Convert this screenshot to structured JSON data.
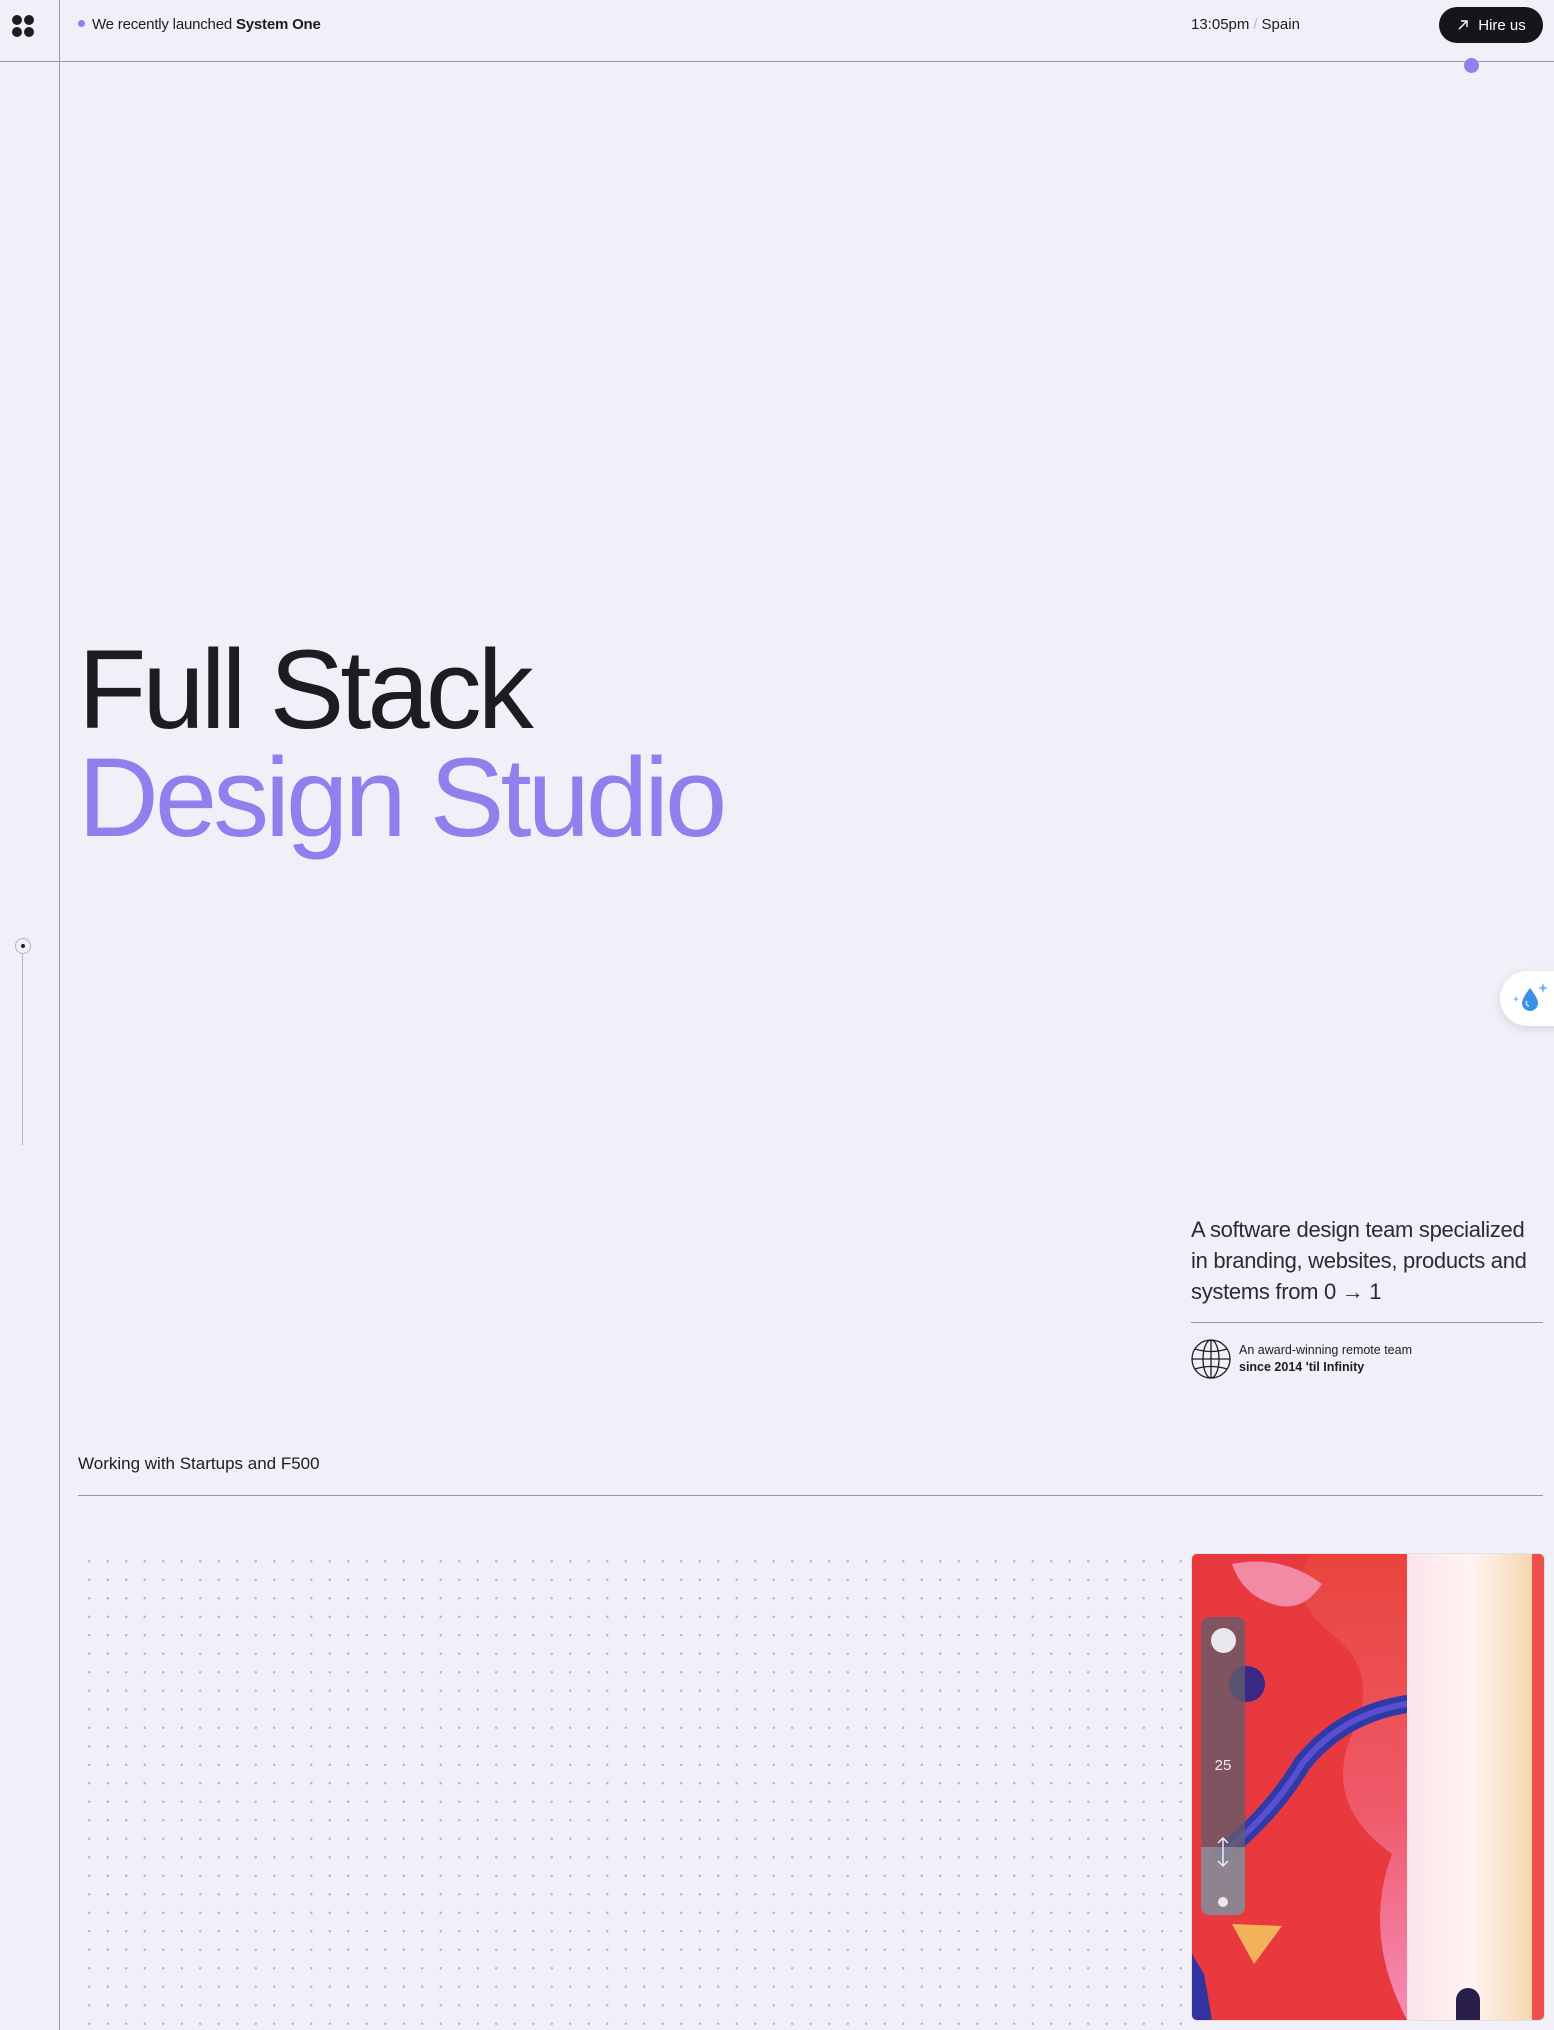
{
  "header": {
    "announcement_prefix": "We recently launched",
    "announcement_strong": "System One",
    "time": "13:05pm",
    "separator": "/",
    "location": "Spain",
    "hire_label": "Hire us"
  },
  "hero": {
    "line1": "Full Stack",
    "line2": "Design Studio"
  },
  "intro": {
    "text": "A software design team specialized in branding, websites, products and systems from 0 → 1",
    "award_line1": "An award-winning remote team",
    "award_line2": "since 2014 'til Infinity"
  },
  "clients": {
    "label": "Working with Startups and F500"
  },
  "art_widget": {
    "slider_value": "25"
  },
  "icons": [
    "logo-icon",
    "arrow-up-right-icon",
    "water-drop-sparkle-icon",
    "globe-icon",
    "vertical-resize-icon"
  ],
  "colors": {
    "background": "#f1f0f9",
    "accent": "#8f80ee",
    "text": "#1d1c21",
    "button": "#16151a"
  }
}
